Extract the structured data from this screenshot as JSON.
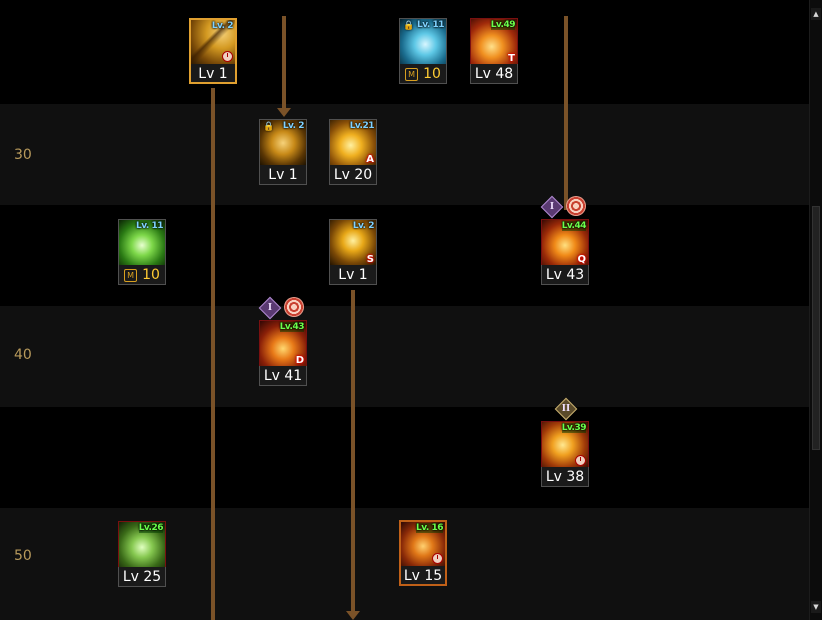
{
  "rows": [
    {
      "label": ""
    },
    {
      "label": "30"
    },
    {
      "label": ""
    },
    {
      "label": "40"
    },
    {
      "label": ""
    },
    {
      "label": "50"
    }
  ],
  "skills": {
    "s1": {
      "tag": "Lv. 2",
      "level": "Lv 1"
    },
    "s2": {
      "tag": "Lv. 11",
      "level": "10"
    },
    "s3": {
      "tag": "Lv.49",
      "level": "Lv 48",
      "badge": "T"
    },
    "s4": {
      "tag": "Lv. 2",
      "level": "Lv 1"
    },
    "s5": {
      "tag": "Lv.21",
      "level": "Lv 20",
      "badge": "A"
    },
    "s6": {
      "tag": "Lv. 11",
      "level": "10"
    },
    "s7": {
      "tag": "Lv. 2",
      "level": "Lv 1",
      "badge": "S"
    },
    "s8": {
      "tag": "Lv.44",
      "level": "Lv 43",
      "badge": "Q"
    },
    "s9": {
      "tag": "Lv.43",
      "level": "Lv 41",
      "badge": "D"
    },
    "s10": {
      "tag": "Lv.39",
      "level": "Lv 38"
    },
    "s11": {
      "tag": "Lv.26",
      "level": "Lv 25"
    },
    "s12": {
      "tag": "Lv. 16",
      "level": "Lv 15"
    }
  },
  "markers": {
    "m_label": "M",
    "rank_one": "I",
    "rank_two": "II"
  },
  "colors": {
    "connector": "#7a5228",
    "row_band": "#101010",
    "row_label": "#b89a5c",
    "lv_tag_blue": "#7fd2ff",
    "lv_tag_green": "#6cff4a"
  }
}
